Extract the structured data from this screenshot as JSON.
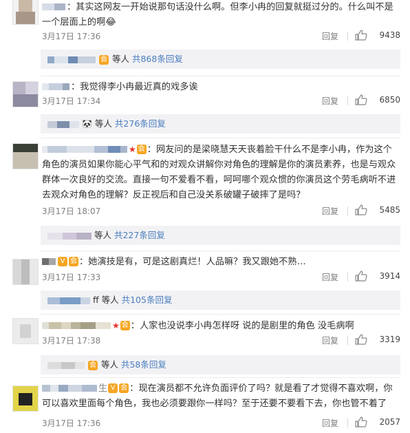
{
  "comments": [
    {
      "text": "：其实这网友一开始说那句话没什么啊。但李小冉的回复就挺过分的。什么叫不是一个层面上的啊😂",
      "time": "3月17日 17:36",
      "reply": "回复",
      "likes": "9438",
      "sub": {
        "suffix": "等人",
        "link": "共868条回复"
      }
    },
    {
      "text": "：我觉得李小冉最近真的戏多诶",
      "time": "3月17日 17:34",
      "reply": "回复",
      "likes": "6850",
      "sub": {
        "suffix": "等人",
        "link": "共276条回复"
      }
    },
    {
      "text": "：网友问的是梁晓慧天天丧着脸干什么不是李小冉，作为这个角色的演员如果你能心平气和的对观众讲解你对角色的理解是你的演员素养，也是与观众群体一次良好的交流。直接一句不爱看不看，呵呵哪个观众惯的你演员这个劳毛病听不进去观众对角色的理解？反正视后和自己没关系破罐子破摔了是吗？",
      "time": "3月17日 18:07",
      "reply": "回复",
      "likes": "5485",
      "sub": {
        "suffix": "等人",
        "link": "共227条回复"
      }
    },
    {
      "text": "：她演技是有，可是这剧真烂！人品嘛？我又跟她不熟…",
      "time": "3月17日 17:33",
      "reply": "回复",
      "likes": "3914",
      "sub": {
        "prefix": "ff",
        "suffix": "等人",
        "link": "共105条回复"
      }
    },
    {
      "text": "：人家也没说李小冉怎样呀 说的是剧里的角色 没毛病啊",
      "time": "3月17日 17:38",
      "reply": "回复",
      "likes": "3319",
      "sub": {
        "suffix": "等人",
        "link": "共58条回复"
      }
    },
    {
      "text": "：现在演员都不允许负面评价了吗？就是看了才觉得不喜欢啊，你可以喜欢里面每个角色，我也必须要跟你一样吗？至于还要不要看下去，你也管不着了",
      "time": "3月17日 17:36",
      "reply": "回复",
      "likes": "2057"
    }
  ],
  "colors": {
    "link": "#4a7dbd",
    "meta": "#808080",
    "subbg": "#f2f2f5",
    "vip": "#f6a623",
    "star": "#e5332a"
  }
}
